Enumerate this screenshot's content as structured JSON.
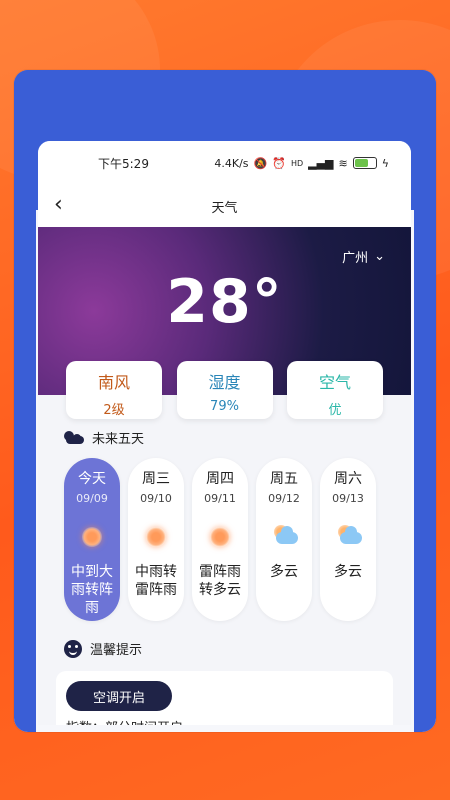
{
  "statusbar": {
    "time": "下午5:29",
    "speed": "4.4K/s",
    "signal": "HD",
    "battery_level": 0.6
  },
  "navbar": {
    "title": "天气",
    "back": "‹"
  },
  "location": {
    "city": "广州"
  },
  "current": {
    "temperature": "28°"
  },
  "stats": [
    {
      "title": "南风",
      "value": "2级",
      "color": "#c25a1a"
    },
    {
      "title": "湿度",
      "value": "79%",
      "color": "#2a86b8"
    },
    {
      "title": "空气",
      "value": "优",
      "color": "#2bb7a8"
    }
  ],
  "forecast_title": "未来五天",
  "forecast": [
    {
      "day": "今天",
      "date": "09/09",
      "desc": "中到大雨转阵雨",
      "icon": "sun-icon",
      "active": true
    },
    {
      "day": "周三",
      "date": "09/10",
      "desc": "中雨转雷阵雨",
      "icon": "sun-icon"
    },
    {
      "day": "周四",
      "date": "09/11",
      "desc": "雷阵雨转多云",
      "icon": "sun-icon"
    },
    {
      "day": "周五",
      "date": "09/12",
      "desc": "多云",
      "icon": "partly-cloudy-icon"
    },
    {
      "day": "周六",
      "date": "09/13",
      "desc": "多云",
      "icon": "partly-cloudy-icon"
    }
  ],
  "tips": {
    "title": "温馨提示",
    "badge": "空调开启",
    "text": "指数：部分时间开启"
  }
}
